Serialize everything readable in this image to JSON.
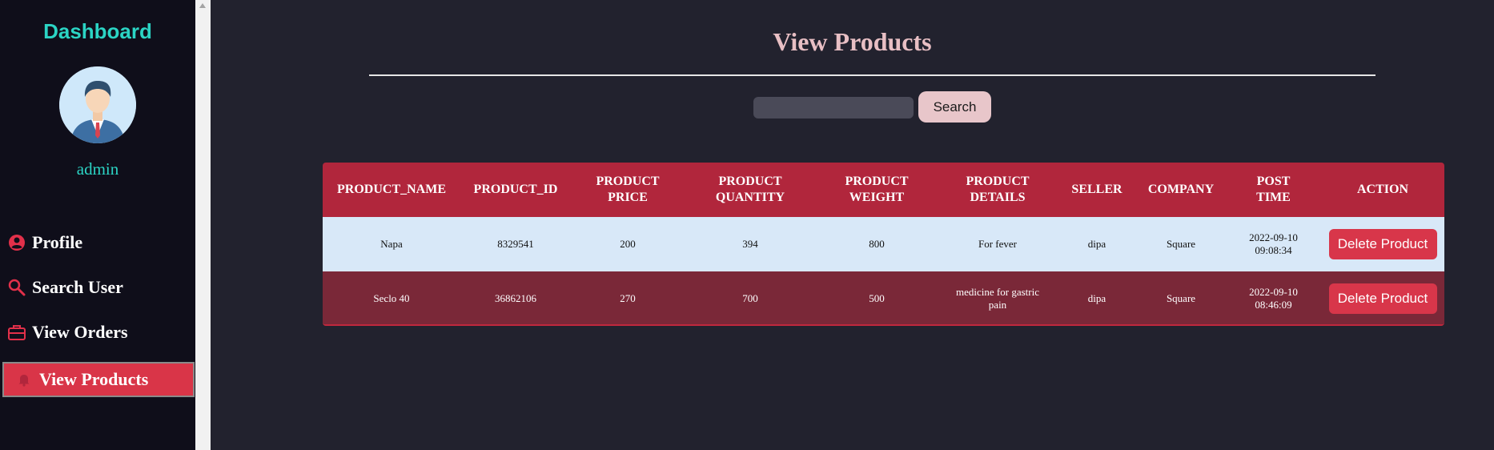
{
  "sidebar": {
    "brand": "Dashboard",
    "username": "admin",
    "items": [
      {
        "label": "Profile",
        "icon": "user-circle-icon"
      },
      {
        "label": "Search User",
        "icon": "search-icon"
      },
      {
        "label": "View Orders",
        "icon": "briefcase-icon"
      },
      {
        "label": "View Products",
        "icon": "bell-icon",
        "active": true
      }
    ]
  },
  "main": {
    "title": "View Products",
    "search": {
      "value": "",
      "placeholder": "",
      "button_label": "Search"
    }
  },
  "table": {
    "headers": [
      "PRODUCT_NAME",
      "PRODUCT_ID",
      "PRODUCT PRICE",
      "PRODUCT QUANTITY",
      "PRODUCT WEIGHT",
      "PRODUCT DETAILS",
      "SELLER",
      "COMPANY",
      "POST TIME",
      "ACTION"
    ],
    "rows": [
      {
        "name": "Napa",
        "id": "8329541",
        "price": "200",
        "quantity": "394",
        "weight": "800",
        "details": "For fever",
        "seller": "dipa",
        "company": "Square",
        "date": "2022-09-10",
        "time": "09:08:34",
        "action": "Delete Product"
      },
      {
        "name": "Seclo 40",
        "id": "36862106",
        "price": "270",
        "quantity": "700",
        "weight": "500",
        "details": "medicine for gastric pain",
        "seller": "dipa",
        "company": "Square",
        "date": "2022-09-10",
        "time": "08:46:09",
        "action": "Delete Product"
      }
    ]
  },
  "colors": {
    "accent": "#2bd4c4",
    "brand_red": "#d93548",
    "header_bg": "#b1263c",
    "title": "#e8bfc4"
  }
}
